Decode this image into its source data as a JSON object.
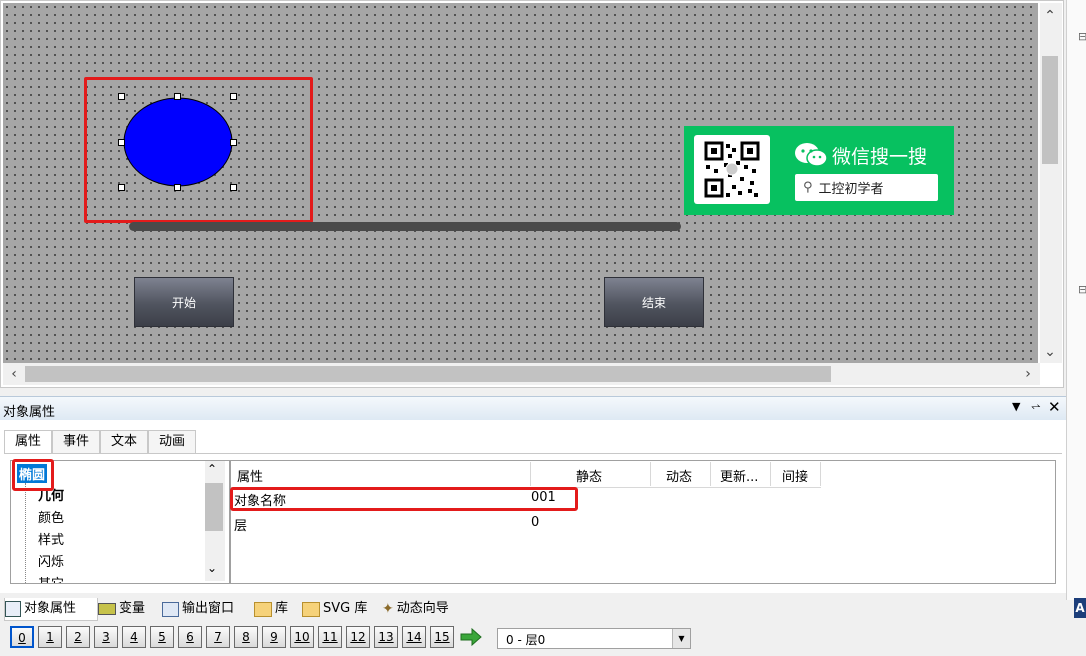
{
  "canvas": {
    "buttons": {
      "start": "开始",
      "end": "结束"
    },
    "wechat_card": {
      "title": "微信搜一搜",
      "search_text": "工控初学者",
      "bg_color": "#07c160"
    }
  },
  "panel": {
    "title": "对象属性",
    "tabs": [
      "属性",
      "事件",
      "文本",
      "动画"
    ],
    "tree": {
      "root": "椭圆",
      "items": [
        "几何",
        "颜色",
        "样式",
        "闪烁",
        "其它"
      ]
    },
    "grid": {
      "headers": [
        "属性",
        "静态",
        "动态",
        "更新...",
        "间接"
      ],
      "rows": [
        {
          "name": "对象名称",
          "value": "001"
        },
        {
          "name": "层",
          "value": "0"
        }
      ]
    }
  },
  "bottom_tabs": [
    "对象属性",
    "变量",
    "输出窗口",
    "库",
    "SVG 库",
    "动态向导"
  ],
  "layers": {
    "buttons": [
      "0",
      "1",
      "2",
      "3",
      "4",
      "5",
      "6",
      "7",
      "8",
      "9",
      "10",
      "11",
      "12",
      "13",
      "14",
      "15"
    ],
    "selected": "0 - 层0"
  },
  "colors": {
    "ellipse_fill": "#0000ff",
    "highlight": "#e31b1b",
    "accent": "#0055cc"
  }
}
